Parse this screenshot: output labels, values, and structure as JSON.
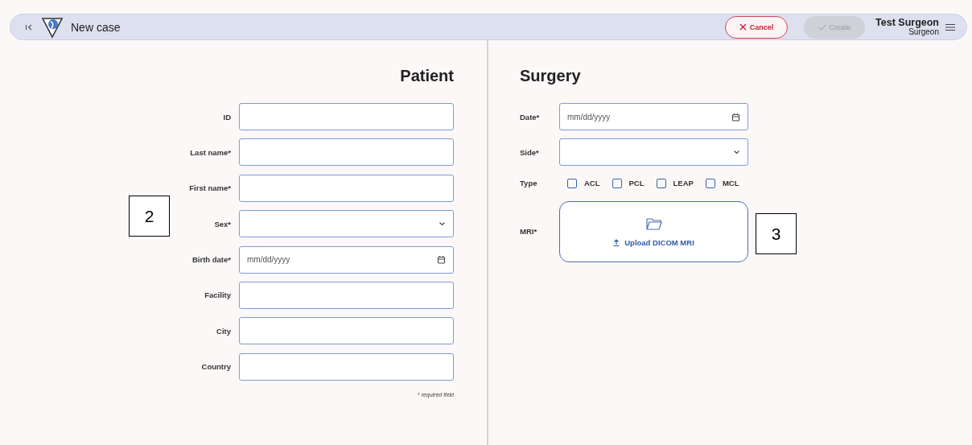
{
  "header": {
    "title": "New case",
    "cancel_button": "Cancel",
    "create_button": {
      "label": "Create",
      "disabled": true
    },
    "user": {
      "name": "Test Surgeon",
      "role": "Surgeon"
    }
  },
  "patient": {
    "heading": "Patient",
    "fields": [
      {
        "label": "ID",
        "kind": "text"
      },
      {
        "label": "Last name*",
        "kind": "text"
      },
      {
        "label": "First name*",
        "kind": "text"
      },
      {
        "label": "Sex*",
        "kind": "select"
      },
      {
        "label": "Birth date*",
        "kind": "date",
        "placeholder": "mm/dd/yyyy"
      },
      {
        "label": "Facility",
        "kind": "text"
      },
      {
        "label": "City",
        "kind": "text"
      },
      {
        "label": "Country",
        "kind": "text"
      }
    ],
    "note": "* required field"
  },
  "surgery": {
    "heading": "Surgery",
    "fields": [
      {
        "label": "Date*",
        "kind": "date",
        "placeholder": "mm/dd/yyyy"
      },
      {
        "label": "Side*",
        "kind": "select"
      },
      {
        "label": "Type",
        "kind": "checks",
        "options": [
          {
            "label": "ACL",
            "checked": false
          },
          {
            "label": "PCL",
            "checked": false
          },
          {
            "label": "LEAP",
            "checked": false
          },
          {
            "label": "MCL",
            "checked": false
          }
        ]
      },
      {
        "label": "MRI*",
        "kind": "upload",
        "button": "Upload DICOM MRI"
      }
    ]
  },
  "callouts": [
    {
      "label": "2"
    },
    {
      "label": "3"
    }
  ]
}
